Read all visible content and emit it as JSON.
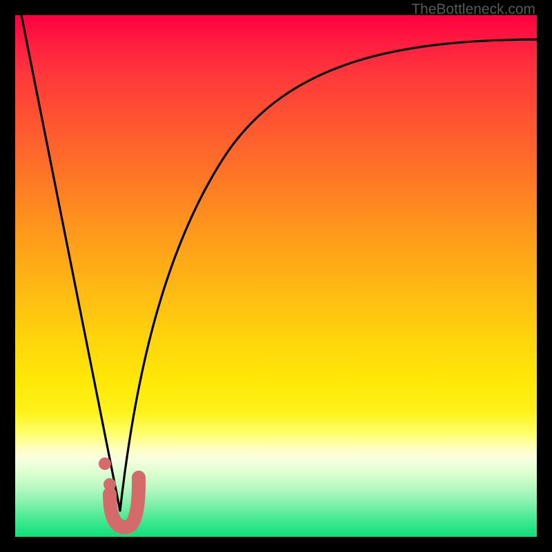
{
  "watermark": "TheBottleneck.com",
  "colors": {
    "frame": "#000000",
    "curve": "#000000",
    "marker_fill": "#d96b6b",
    "marker_stroke": "#d96b6b"
  },
  "chart_data": {
    "type": "line",
    "title": "",
    "xlabel": "",
    "ylabel": "",
    "xlim": [
      0,
      100
    ],
    "ylim": [
      0,
      100
    ],
    "grid": false,
    "legend": false,
    "series": [
      {
        "name": "left-branch",
        "x": [
          0,
          5,
          10,
          15,
          17,
          18,
          19,
          20
        ],
        "y": [
          100,
          76,
          50,
          25,
          15,
          10,
          5,
          0
        ]
      },
      {
        "name": "right-branch",
        "x": [
          20,
          22,
          25,
          30,
          35,
          40,
          50,
          60,
          70,
          80,
          90,
          100
        ],
        "y": [
          0,
          15,
          35,
          55,
          66,
          74,
          83,
          88,
          91,
          93,
          94.5,
          95
        ]
      }
    ],
    "markers": {
      "name": "bottleneck-optimum",
      "shape": "J",
      "points": [
        {
          "x": 17.5,
          "y": 14
        },
        {
          "x": 18.5,
          "y": 9
        },
        {
          "x": 18.5,
          "y": 5
        },
        {
          "x": 19,
          "y": 2.5
        },
        {
          "x": 20.2,
          "y": 1.5
        },
        {
          "x": 21.5,
          "y": 2.5
        },
        {
          "x": 22.2,
          "y": 5.5
        },
        {
          "x": 22.8,
          "y": 10.5
        }
      ]
    }
  }
}
